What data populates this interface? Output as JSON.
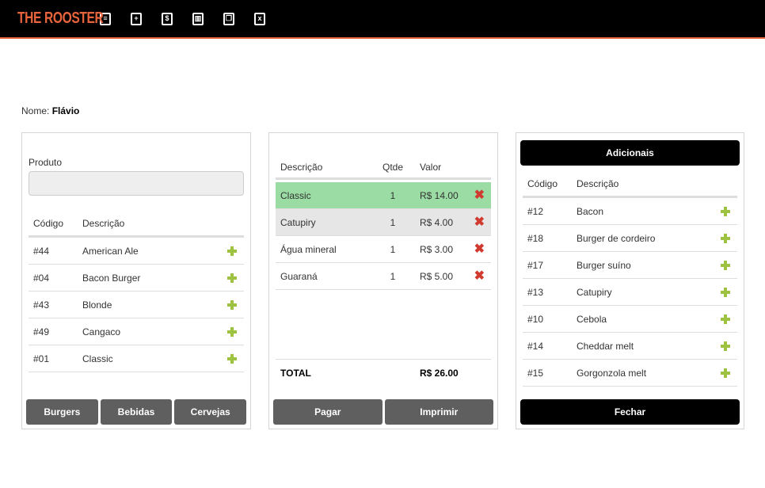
{
  "brand": "THE ROOSTER",
  "nav": [
    {
      "name": "list-icon",
      "glyph": "≡"
    },
    {
      "name": "add-icon",
      "glyph": "+"
    },
    {
      "name": "money-icon",
      "glyph": "$"
    },
    {
      "name": "chart-icon",
      "glyph": "▥"
    },
    {
      "name": "copy-icon",
      "glyph": "❐"
    },
    {
      "name": "close-doc-icon",
      "glyph": "x"
    }
  ],
  "customer": {
    "label": "Nome:",
    "name": "Flávio"
  },
  "produtos": {
    "input_label": "Produto",
    "search_value": "",
    "search_placeholder": "",
    "columns": {
      "code": "Código",
      "desc": "Descrição"
    },
    "rows": [
      {
        "code": "#44",
        "desc": "American Ale"
      },
      {
        "code": "#04",
        "desc": "Bacon Burger"
      },
      {
        "code": "#43",
        "desc": "Blonde"
      },
      {
        "code": "#49",
        "desc": "Cangaco"
      },
      {
        "code": "#01",
        "desc": "Classic"
      }
    ],
    "buttons": [
      "Burgers",
      "Bebidas",
      "Cervejas"
    ]
  },
  "pedido": {
    "columns": {
      "desc": "Descrição",
      "qty": "Qtde",
      "val": "Valor"
    },
    "rows": [
      {
        "desc": "Classic",
        "qty": "1",
        "val": "R$ 14.00",
        "highlight": "#9adca3"
      },
      {
        "desc": "Catupiry",
        "qty": "1",
        "val": "R$ 4.00",
        "highlight": "#e6e6e6"
      },
      {
        "desc": "Água mineral",
        "qty": "1",
        "val": "R$ 3.00",
        "highlight": ""
      },
      {
        "desc": "Guaraná",
        "qty": "1",
        "val": "R$ 5.00",
        "highlight": ""
      }
    ],
    "total_label": "TOTAL",
    "total_value": "R$ 26.00",
    "buttons": [
      "Pagar",
      "Imprimir"
    ]
  },
  "adicionais": {
    "title": "Adicionais",
    "columns": {
      "code": "Código",
      "desc": "Descrição"
    },
    "rows": [
      {
        "code": "#12",
        "desc": "Bacon"
      },
      {
        "code": "#18",
        "desc": "Burger de cordeiro"
      },
      {
        "code": "#17",
        "desc": "Burger suíno"
      },
      {
        "code": "#13",
        "desc": "Catupiry"
      },
      {
        "code": "#10",
        "desc": "Cebola"
      },
      {
        "code": "#14",
        "desc": "Cheddar melt"
      },
      {
        "code": "#15",
        "desc": "Gorgonzola melt"
      }
    ],
    "close_label": "Fechar"
  },
  "colors": {
    "accent": "#e8643c",
    "plus": "#9cc23f",
    "remove": "#d13a2f",
    "button": "#5f5f5f"
  }
}
